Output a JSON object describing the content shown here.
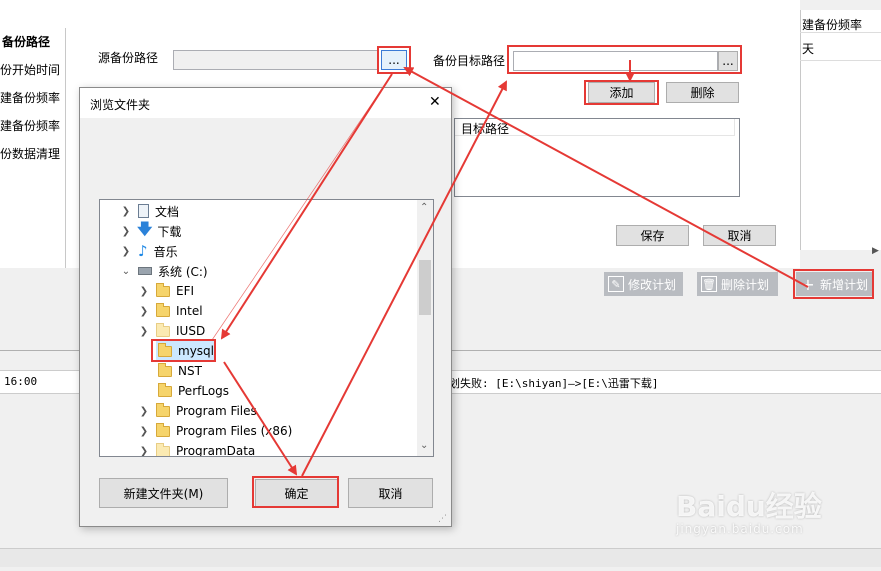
{
  "sidebar": {
    "items": [
      "备份路径",
      "份开始时间",
      "建备份频率",
      "建备份频率",
      "份数据清理"
    ]
  },
  "right_table": {
    "header": "建备份频率",
    "cell": "天"
  },
  "form": {
    "source_label": "源备份路径",
    "source_browse": "...",
    "target_label": "备份目标路径",
    "target_browse": "...",
    "add_button": "添加",
    "delete_button": "删除",
    "list_header": "目标路径",
    "save_button": "保存",
    "cancel_button": "取消"
  },
  "toolbar": {
    "edit_plan": "修改计划",
    "delete_plan": "删除计划",
    "new_plan": "新增计划"
  },
  "log": {
    "time": "16:00",
    "message": "计划失败: [E:\\shiyan]—>[E:\\迅雷下载]"
  },
  "dialog": {
    "title": "浏览文件夹",
    "close": "✕",
    "tree": [
      {
        "label": "文档",
        "icon": "document-icon"
      },
      {
        "label": "下载",
        "icon": "download-icon"
      },
      {
        "label": "音乐",
        "icon": "music-icon"
      },
      {
        "label": "系统 (C:)",
        "icon": "drive-icon"
      },
      {
        "label": "EFI",
        "icon": "folder-icon"
      },
      {
        "label": "Intel",
        "icon": "folder-icon"
      },
      {
        "label": "IUSD",
        "icon": "folder-icon"
      },
      {
        "label": "mysql",
        "icon": "folder-icon"
      },
      {
        "label": "NST",
        "icon": "folder-icon"
      },
      {
        "label": "PerfLogs",
        "icon": "folder-icon"
      },
      {
        "label": "Program Files",
        "icon": "folder-icon"
      },
      {
        "label": "Program Files (x86)",
        "icon": "folder-icon"
      },
      {
        "label": "ProgramData",
        "icon": "folder-icon"
      }
    ],
    "new_folder_button": "新建文件夹(M)",
    "ok_button": "确定",
    "cancel_button": "取消"
  },
  "watermark": {
    "brand": "Baidu经验",
    "url": "jingyan.baidu.com"
  },
  "colors": {
    "accent_red": "#e53935",
    "selection": "#cce8ff",
    "toolbar_gray": "#b9bcc1"
  }
}
